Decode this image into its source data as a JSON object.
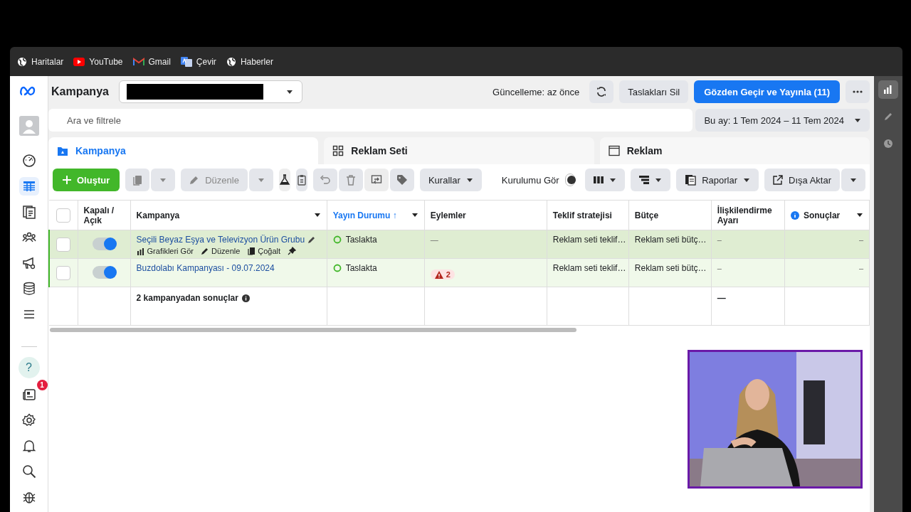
{
  "bookmarks": [
    {
      "label": "Haritalar",
      "kind": "globe"
    },
    {
      "label": "YouTube",
      "kind": "youtube"
    },
    {
      "label": "Gmail",
      "kind": "gmail"
    },
    {
      "label": "Çevir",
      "kind": "translate"
    },
    {
      "label": "Haberler",
      "kind": "globe"
    }
  ],
  "nav": {
    "items": [
      {
        "kind": "gauge",
        "selected": false
      },
      {
        "kind": "table",
        "selected": true
      },
      {
        "kind": "pages",
        "selected": false
      },
      {
        "kind": "people",
        "selected": false
      },
      {
        "kind": "megaphone",
        "selected": false
      },
      {
        "kind": "coins",
        "selected": false
      },
      {
        "kind": "menu",
        "selected": false
      }
    ],
    "bottom": [
      {
        "kind": "help",
        "label": "?"
      },
      {
        "kind": "news",
        "badge": "1"
      },
      {
        "kind": "settings"
      },
      {
        "kind": "bell"
      },
      {
        "kind": "search"
      },
      {
        "kind": "bug"
      }
    ]
  },
  "header": {
    "title": "Kampanya",
    "update_text": "Güncelleme: az önce",
    "delete_drafts": "Taslakları Sil",
    "publish": "Gözden Geçir ve Yayınla (11)"
  },
  "search": {
    "placeholder": "Ara ve filtrele"
  },
  "date_range": "Bu ay: 1 Tem 2024 – 11 Tem 2024",
  "level_tabs": [
    {
      "label": "Kampanya",
      "kind": "folder",
      "selected": true
    },
    {
      "label": "Reklam Seti",
      "kind": "grid",
      "selected": false
    },
    {
      "label": "Reklam",
      "kind": "window",
      "selected": false
    }
  ],
  "toolbar": {
    "create": "Oluştur",
    "edit": "Düzenle",
    "rules": "Kurallar",
    "setup_label": "Kurulumu Gör",
    "setup_on": false,
    "reports": "Raporlar",
    "export": "Dışa Aktar"
  },
  "table": {
    "select_all_checked": false,
    "columns": [
      {
        "label": "Kapalı / Açık",
        "active": false,
        "menu": false
      },
      {
        "label": "Kampanya",
        "active": false,
        "menu": true
      },
      {
        "label": "Yayın Durumu ↑",
        "active": true,
        "menu": true
      },
      {
        "label": "Eylemler",
        "active": false,
        "menu": false
      },
      {
        "label": "Teklif stratejisi",
        "active": false,
        "menu": false
      },
      {
        "label": "Bütçe",
        "active": false,
        "menu": false
      },
      {
        "label": "İlişkilendirme Ayarı",
        "active": false,
        "menu": false
      },
      {
        "label": "Sonuçlar",
        "active": false,
        "menu": true,
        "info": true
      }
    ],
    "rows": [
      {
        "name": "Seçili Beyaz Eşya ve Televizyon Ürün Grubu",
        "hovered": true,
        "checked": false,
        "on": true,
        "row_actions": [
          "Grafikleri Gör",
          "Düzenle",
          "Çoğalt"
        ],
        "status": "Taslakta",
        "actions": "—",
        "bid": "Reklam seti teklif…",
        "budget": "Reklam seti bütç…",
        "attribution": "–",
        "results": "–"
      },
      {
        "name": "Buzdolabı Kampanyası - 09.07.2024",
        "hovered": false,
        "checked": false,
        "on": true,
        "status": "Taslakta",
        "issues": "2",
        "bid": "Reklam seti teklif…",
        "budget": "Reklam seti bütç…",
        "attribution": "–",
        "results": "–"
      }
    ],
    "summary": {
      "label": "2 kampanyadan sonuçlar",
      "attribution": "—"
    }
  }
}
